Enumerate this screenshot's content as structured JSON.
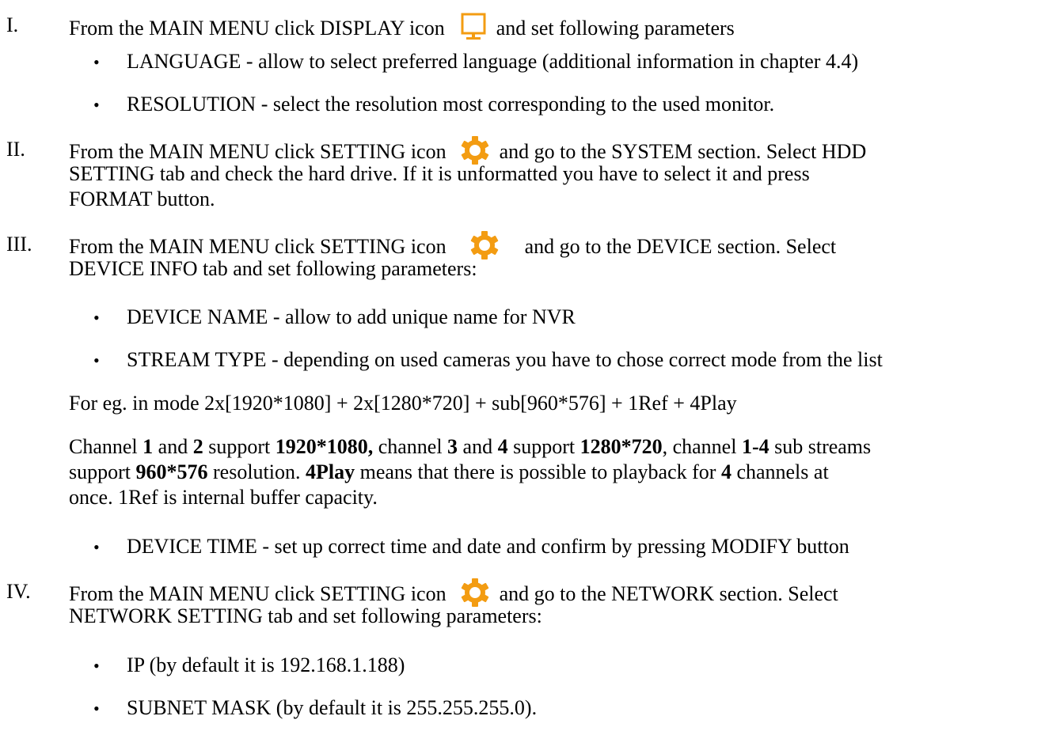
{
  "steps": [
    {
      "numeral": "I.",
      "before": "From the MAIN MENU click  DISPLAY icon",
      "icon": "display-monitor-icon",
      "after": "and set following parameters",
      "bullets": [
        "LANGUAGE - allow to select preferred language (additional information in chapter 4.4)",
        "RESOLUTION - select the resolution most corresponding to the used monitor."
      ]
    },
    {
      "numeral": "II.",
      "before": "From the MAIN MENU click SETTING icon",
      "icon": "gear-icon",
      "after": "and go to the SYSTEM section. Select HDD",
      "line2": "SETTING tab and check the hard drive. If it is unformatted you have to select it and press",
      "line3": "FORMAT button."
    },
    {
      "numeral": "III.",
      "before": "From the MAIN MENU click SETTING icon",
      "icon": "gear-icon",
      "after": "and go to the DEVICE section. Select",
      "line2": "DEVICE INFO tab and set following parameters:",
      "bullets": [
        "DEVICE NAME - allow to add unique name for NVR",
        "STREAM TYPE - depending on used cameras you have to chose correct mode from the list"
      ],
      "example": "For eg. in mode 2x[1920*1080] + 2x[1280*720] + sub[960*576] + 1Ref + 4Play",
      "detail": {
        "t1": "Channel ",
        "b1": "1",
        "t2": " and ",
        "b2": "2",
        "t3": " support ",
        "b3": "1920*1080,",
        "t4": " channel ",
        "b4": "3",
        "t5": " and ",
        "b5": "4",
        "t6": " support ",
        "b6": "1280*720",
        "t7": ", channel ",
        "b7": "1-4",
        "t8": " sub streams",
        "t9": "support ",
        "b9": "960*576",
        "t10": " resolution. ",
        "b10": "4Play",
        "t11": " means that there is possible to playback for ",
        "b11": "4",
        "t12": " channels at",
        "t13": "once. 1Ref is internal buffer capacity."
      },
      "bullet3": "DEVICE TIME - set up correct time and date and confirm by pressing MODIFY button"
    },
    {
      "numeral": "IV.",
      "before": "From the MAIN MENU click SETTING icon",
      "icon": "gear-icon",
      "after": "and go to the NETWORK section.  Select",
      "line2": "NETWORK SETTING tab and set following parameters:",
      "bullets": [
        "IP  (by default it is 192.168.1.188)",
        "SUBNET MASK (by default it is 255.255.255.0)."
      ]
    }
  ],
  "colors": {
    "accent": "#f39c12",
    "text": "#000000"
  },
  "bullet_glyph": "•"
}
